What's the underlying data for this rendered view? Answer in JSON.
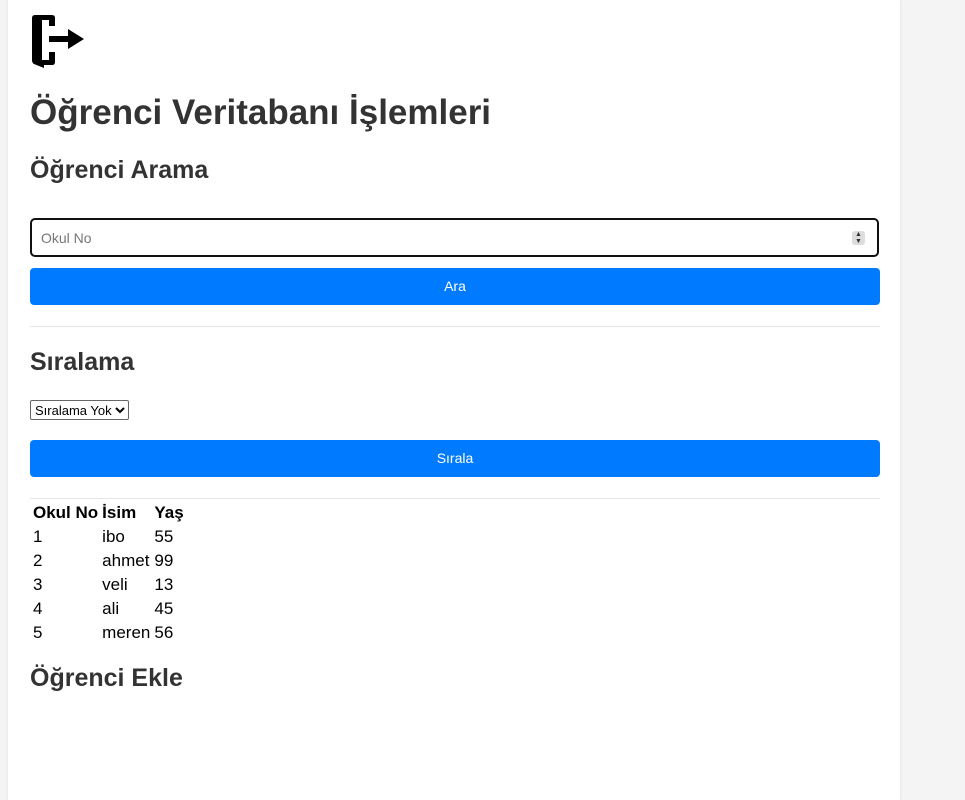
{
  "page_title": "Öğrenci Veritabanı İşlemleri",
  "search": {
    "heading": "Öğrenci Arama",
    "placeholder": "Okul No",
    "button_label": "Ara"
  },
  "sort": {
    "heading": "Sıralama",
    "selected_option": "Sıralama Yok",
    "button_label": "Sırala"
  },
  "table": {
    "headers": [
      "Okul No",
      "İsim",
      "Yaş"
    ],
    "rows": [
      [
        "1",
        "ibo",
        "55"
      ],
      [
        "2",
        "ahmet",
        "99"
      ],
      [
        "3",
        "veli",
        "13"
      ],
      [
        "4",
        "ali",
        "45"
      ],
      [
        "5",
        "meren",
        "56"
      ]
    ]
  },
  "add": {
    "heading": "Öğrenci Ekle"
  },
  "icons": {
    "logout": "logout-door-icon"
  },
  "colors": {
    "accent": "#007bff",
    "text": "#333333"
  }
}
